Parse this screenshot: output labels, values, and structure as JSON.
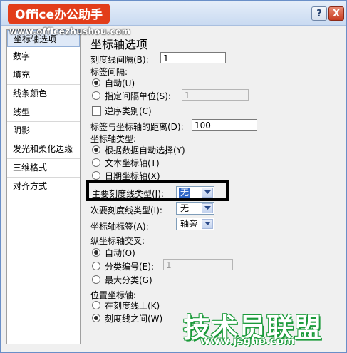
{
  "window": {
    "title": "Office办公助手",
    "watermark_url": "www.officezhushou.com",
    "help_label": "?",
    "close_label": "X"
  },
  "sidebar": {
    "items": [
      {
        "label": "坐标轴选项",
        "selected": true
      },
      {
        "label": "数字"
      },
      {
        "label": "填充"
      },
      {
        "label": "线条颜色"
      },
      {
        "label": "线型"
      },
      {
        "label": "阴影"
      },
      {
        "label": "发光和柔化边缘"
      },
      {
        "label": "三维格式"
      },
      {
        "label": "对齐方式"
      }
    ]
  },
  "panel": {
    "title": "坐标轴选项",
    "tick_interval": {
      "label": "刻度线间隔(B):",
      "value": "1"
    },
    "label_interval": {
      "label": "标签间隔:",
      "auto": {
        "label": "自动(U)",
        "selected": true
      },
      "specified": {
        "label": "指定间隔单位(S):",
        "value": "1",
        "selected": false
      }
    },
    "reverse_order": {
      "label": "逆序类别(C)",
      "checked": false
    },
    "label_distance": {
      "label": "标签与坐标轴的距离(D):",
      "value": "100"
    },
    "axis_type": {
      "label": "坐标轴类型:",
      "options": [
        {
          "label": "根据数据自动选择(Y)",
          "selected": true
        },
        {
          "label": "文本坐标轴(T)",
          "selected": false
        },
        {
          "label": "日期坐标轴(X)",
          "selected": false
        }
      ]
    },
    "major_tick_type": {
      "label": "主要刻度线类型(J):",
      "value": "无"
    },
    "minor_tick_type": {
      "label": "次要刻度线类型(I):",
      "value": "无"
    },
    "axis_labels": {
      "label": "坐标轴标签(A):",
      "value": "轴旁"
    },
    "vertical_axis_crosses": {
      "label": "纵坐标轴交叉:",
      "auto": {
        "label": "自动(O)",
        "selected": true
      },
      "category_number": {
        "label": "分类编号(E):",
        "value": "1",
        "selected": false
      },
      "max_category": {
        "label": "最大分类(G)",
        "selected": false
      }
    },
    "position_axis": {
      "label": "位置坐标轴:",
      "on_tick": {
        "label": "在刻度线上(K)",
        "selected": false
      },
      "between_ticks": {
        "label": "刻度线之间(W)",
        "selected": true
      }
    }
  },
  "watermark": {
    "logo_text": "技术员联盟",
    "logo_url": "www.jsgho.com"
  }
}
